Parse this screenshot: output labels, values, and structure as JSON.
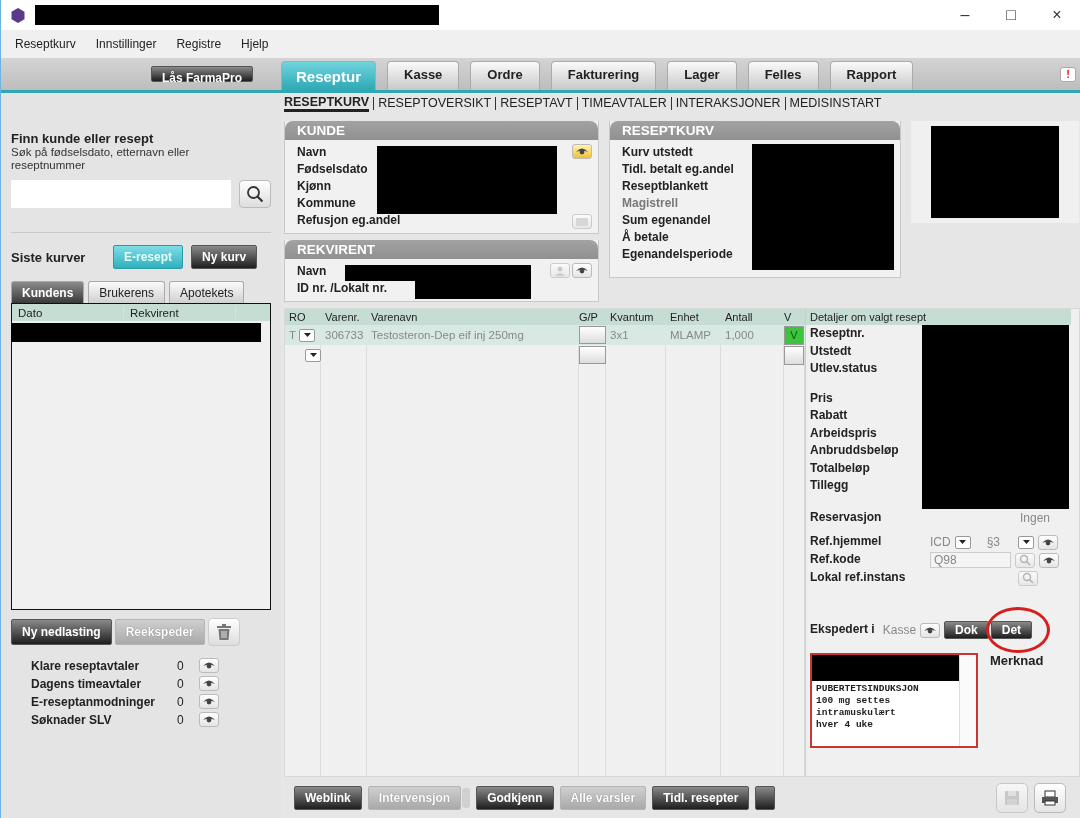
{
  "window": {
    "controls": [
      "–",
      "□",
      "×"
    ]
  },
  "menu": [
    "Reseptkurv",
    "Innstillinger",
    "Registre",
    "Hjelp"
  ],
  "lock_button": "Lås FarmaPro",
  "tabs": [
    {
      "label": "Reseptur",
      "selected": true
    },
    {
      "label": "Kasse",
      "selected": false
    },
    {
      "label": "Ordre",
      "selected": false
    },
    {
      "label": "Fakturering",
      "selected": false
    },
    {
      "label": "Lager",
      "selected": false
    },
    {
      "label": "Felles",
      "selected": false
    },
    {
      "label": "Rapport",
      "selected": false
    }
  ],
  "alert_badge": "!",
  "subnav": [
    {
      "label": "RESEPTKURV",
      "selected": true
    },
    {
      "label": "RESEPTOVERSIKT",
      "selected": false
    },
    {
      "label": "RESEPTAVT",
      "selected": false
    },
    {
      "label": "TIMEAVTALER",
      "selected": false
    },
    {
      "label": "INTERAKSJONER",
      "selected": false
    },
    {
      "label": "MEDISINSTART",
      "selected": false
    }
  ],
  "search": {
    "title": "Finn kunde eller resept",
    "hint": "Søk på fødselsdato, etternavn eller reseptnummer"
  },
  "recent": {
    "label": "Siste kurver",
    "buttons": [
      {
        "label": "E-resept",
        "kind": "accent"
      },
      {
        "label": "Ny kurv",
        "kind": "dark"
      }
    ]
  },
  "list_tabs": [
    {
      "label": "Kundens",
      "selected": true
    },
    {
      "label": "Brukerens",
      "selected": false
    },
    {
      "label": "Apotekets",
      "selected": false
    }
  ],
  "list_columns": [
    "Dato",
    "Rekvirent"
  ],
  "list_actions": [
    {
      "label": "Ny nedlasting",
      "disabled": false
    },
    {
      "label": "Reekspeder",
      "disabled": true
    }
  ],
  "counters": [
    {
      "label": "Klare reseptavtaler",
      "count": "0"
    },
    {
      "label": "Dagens timeavtaler",
      "count": "0"
    },
    {
      "label": "E-reseptanmodninger",
      "count": "0"
    },
    {
      "label": "Søknader SLV",
      "count": "0"
    }
  ],
  "kunde": {
    "title": "KUNDE",
    "fields": [
      {
        "label": "Navn",
        "disabled": false
      },
      {
        "label": "Fødselsdato",
        "disabled": false
      },
      {
        "label": "Kjønn",
        "disabled": false
      },
      {
        "label": "Kommune",
        "disabled": false
      },
      {
        "label": "Refusjon eg.andel",
        "disabled": false
      }
    ]
  },
  "rekvirent": {
    "title": "REKVIRENT",
    "fields": [
      {
        "label": "Navn",
        "disabled": false
      },
      {
        "label": "ID nr. /Lokalt nr.",
        "disabled": false
      }
    ]
  },
  "reseptkurv": {
    "title": "RESEPTKURV",
    "fields": [
      {
        "label": "Kurv utstedt",
        "disabled": false
      },
      {
        "label": "Tidl. betalt eg.andel",
        "disabled": false
      },
      {
        "label": "Reseptblankett",
        "disabled": false
      },
      {
        "label": "Magistrell",
        "disabled": true
      },
      {
        "label": "Sum egenandel",
        "disabled": false
      },
      {
        "label": "Å betale",
        "disabled": false
      },
      {
        "label": "Egenandelsperiode",
        "disabled": false
      }
    ]
  },
  "grid": {
    "columns": [
      "RO",
      "Varenr.",
      "Varenavn",
      "G/P",
      "Kvantum",
      "Enhet",
      "Antall",
      "V"
    ],
    "rows": [
      {
        "ro": "T",
        "varenr": "306733",
        "varenavn": "Testosteron-Dep eif inj 250mg",
        "kvantum": "3x1",
        "enhet": "MLAMP",
        "antall": "1,000",
        "v": "V",
        "checked": true,
        "generic": false
      }
    ],
    "new_row": {
      "checked": false,
      "generic": false
    }
  },
  "details": {
    "title": "Detaljer om valgt resept",
    "groups": [
      [
        "Reseptnr.",
        "Utstedt",
        "Utlev.status"
      ],
      [
        "Pris",
        "Rabatt",
        "Arbeidspris",
        "Anbruddsbeløp",
        "Totalbeløp",
        "Tillegg"
      ]
    ],
    "reservasjon": {
      "label": "Reservasjon",
      "value": "Ingen"
    },
    "ref_hjemmel": {
      "label": "Ref.hjemmel",
      "code": "ICD",
      "paragraph": "§3"
    },
    "ref_kode": {
      "label": "Ref.kode",
      "value": "Q98"
    },
    "lokal": {
      "label": "Lokal ref.instans"
    },
    "ekspedert": {
      "label": "Ekspedert i",
      "value": "Kasse",
      "buttons": [
        "Dok",
        "Det"
      ]
    },
    "note": {
      "lines": [
        "PUBERTETSINDUKSJON",
        "100 mg settes",
        "intramuskulært",
        "hver 4 uke"
      ]
    },
    "merknad": "Merknad"
  },
  "bottom_buttons": [
    {
      "label": "Weblink",
      "disabled": false
    },
    {
      "label": "Intervensjon",
      "disabled": true
    },
    {
      "label": "Godkjenn",
      "disabled": false
    },
    {
      "label": "Alle varsler",
      "disabled": true
    },
    {
      "label": "Tidl. resepter",
      "disabled": false
    }
  ]
}
